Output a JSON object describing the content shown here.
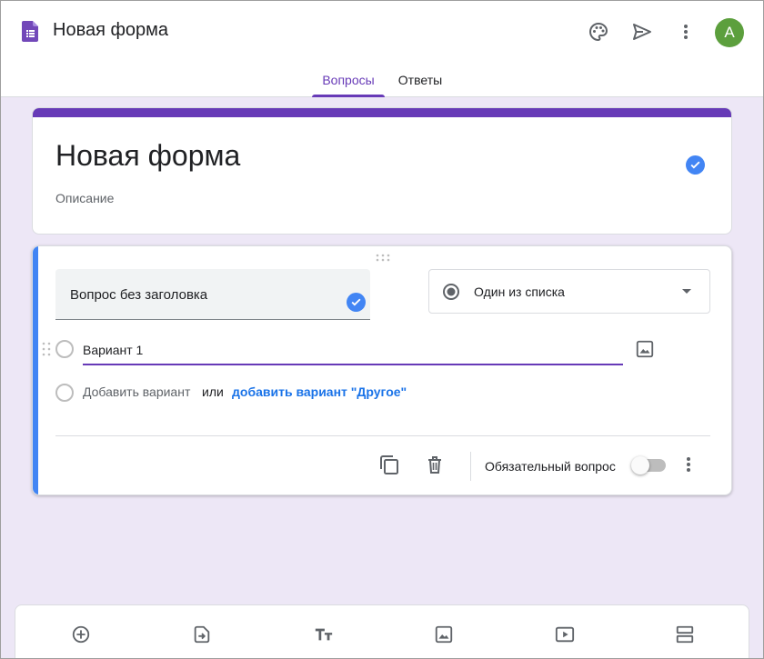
{
  "header": {
    "app_title": "Новая форма",
    "avatar_letter": "A",
    "avatar_color": "#5c9f3d",
    "icons": [
      "forms-app-icon",
      "palette-icon",
      "send-icon",
      "more-vert-icon"
    ]
  },
  "tabs": [
    {
      "label": "Вопросы",
      "active": true
    },
    {
      "label": "Ответы",
      "active": false
    }
  ],
  "form": {
    "title": "Новая форма",
    "description": "Описание"
  },
  "question": {
    "title": "Вопрос без заголовка",
    "type": "Один из списка",
    "options": [
      "Вариант 1"
    ],
    "add_option": "Добавить вариант",
    "or": "или",
    "add_other": "добавить вариант \"Другое\"",
    "required_label": "Обязательный вопрос",
    "required": false
  },
  "toolbar": {
    "icons": [
      "add-question-icon",
      "import-questions-icon",
      "title-text-icon",
      "add-image-icon",
      "add-video-icon",
      "add-section-icon"
    ]
  },
  "colors": {
    "accent": "#673ab7",
    "background": "#ede7f6",
    "question_bar": "#4285f4",
    "link": "#1a73e8"
  }
}
